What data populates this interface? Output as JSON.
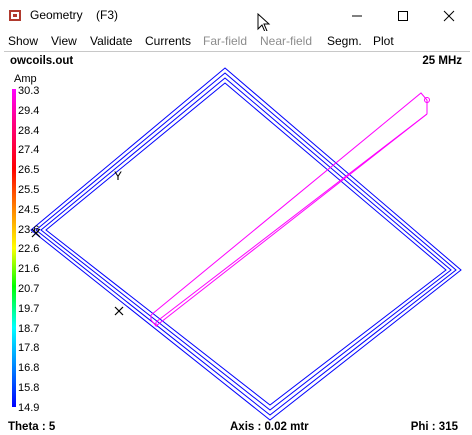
{
  "window": {
    "title": "Geometry    (F3)",
    "icon": "app-cube-icon"
  },
  "menu": [
    {
      "label": "Show",
      "enabled": true
    },
    {
      "label": "View",
      "enabled": true
    },
    {
      "label": "Validate",
      "enabled": true
    },
    {
      "label": "Currents",
      "enabled": true
    },
    {
      "label": "Far-field",
      "enabled": false
    },
    {
      "label": "Near-field",
      "enabled": false
    },
    {
      "label": "Segm.",
      "enabled": true
    },
    {
      "label": "Plot",
      "enabled": true
    }
  ],
  "view": {
    "filename": "owcoils.out",
    "frequency": "25 MHz",
    "unit": "Amp",
    "scale_ticks": [
      "30.3",
      "29.4",
      "28.4",
      "27.4",
      "26.5",
      "25.5",
      "24.5",
      "23.6",
      "22.6",
      "21.6",
      "20.7",
      "19.7",
      "18.7",
      "17.8",
      "16.8",
      "15.8",
      "14.9"
    ],
    "axis_labels": {
      "y": "Y",
      "x": "X"
    },
    "footer": {
      "theta": "Theta : 5",
      "axis": "Axis : 0.02 mtr",
      "phi": "Phi : 315"
    },
    "colors": {
      "coil": "#0000ff",
      "feed": "#ff00ff"
    }
  }
}
